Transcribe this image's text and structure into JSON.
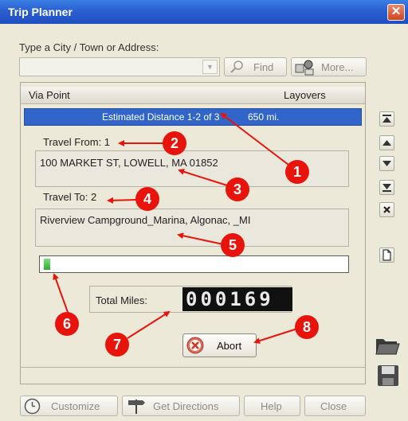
{
  "window": {
    "title": "Trip Planner",
    "close_glyph": "✕"
  },
  "search": {
    "label": "Type a City / Town or Address:",
    "value": "",
    "find_label": "Find",
    "more_label": "More..."
  },
  "list": {
    "columns": [
      "Via Point",
      "Layovers"
    ],
    "estimated_text": "Estimated Distance 1-2 of 3",
    "estimated_miles": "650 mi."
  },
  "travel_from": {
    "label": "Travel From: 1",
    "address": "100 MARKET ST, LOWELL, MA 01852"
  },
  "travel_to": {
    "label": "Travel To: 2",
    "address": "Riverview Campground_Marina, Algonac, _MI"
  },
  "progress": {
    "fraction": 0.02,
    "color": "#3cc03c"
  },
  "total": {
    "label": "Total Miles:",
    "odometer": "000169"
  },
  "abort": {
    "label": "Abort"
  },
  "footer": {
    "customize": "Customize",
    "get_directions": "Get Directions",
    "help": "Help",
    "close": "Close"
  },
  "annotations": {
    "color": "#ff0000",
    "callouts": [
      "1",
      "2",
      "3",
      "4",
      "5",
      "6",
      "7",
      "8"
    ]
  },
  "colors": {
    "titlebar": "#2a5fd0",
    "highlight": "#3165c9",
    "annotation_red": "#e8140c"
  }
}
